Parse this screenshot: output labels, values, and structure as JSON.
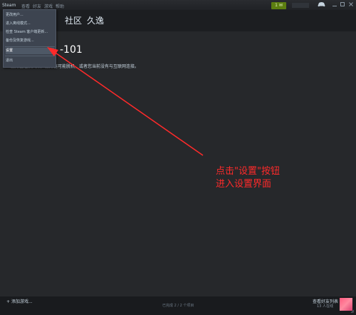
{
  "titlebar": {
    "menu": [
      "Steam",
      "查看",
      "好友",
      "游戏",
      "帮助"
    ],
    "notification_count": "1"
  },
  "nav": [
    "社区",
    "久逸"
  ],
  "dropdown": {
    "items": [
      "更改用户...",
      "进入离线模式...",
      "检查 Steam 客户端更新...",
      "备份及恢复游戏...",
      "设置",
      "退出"
    ],
    "active_index": 4
  },
  "error": {
    "title": "-101",
    "description": "服务器连接失败。服务器可能脱机，或者您当前没有与互联网连接。"
  },
  "annotation": {
    "line1": "点击\"设置\"按钮",
    "line2": "进入设置界面",
    "color": "#ff2a2a"
  },
  "footer": {
    "add_game": "添加游戏...",
    "downloads": "已完成 2 / 2 个项目",
    "friends_list": "查看好友列表",
    "friends_online": "13 人在线"
  },
  "colors": {
    "background": "#26282b",
    "accent_green": "#5c7e10",
    "dropdown_bg": "#3d4450"
  }
}
